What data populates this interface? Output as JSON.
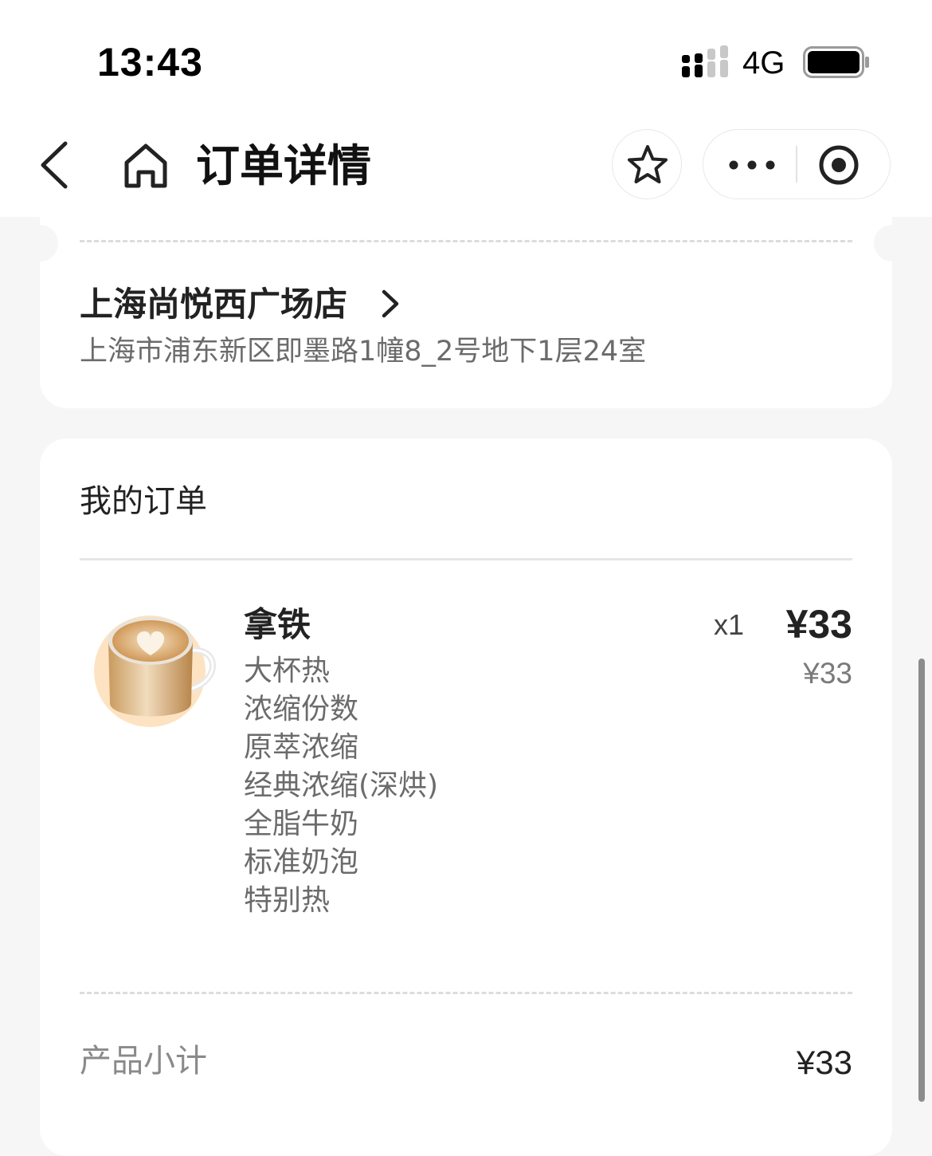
{
  "status_bar": {
    "time": "13:43",
    "network": "4G",
    "icons": [
      "signal-icon",
      "battery-icon"
    ]
  },
  "nav": {
    "title": "订单详情",
    "icons": [
      "back-arrow-icon",
      "home-icon",
      "star-icon",
      "more-dots-icon",
      "close-target-icon"
    ]
  },
  "store": {
    "name": "上海尚悦西广场店",
    "address": "上海市浦东新区即墨路1幢8_2号地下1层24室",
    "icon": "chevron-right-icon"
  },
  "order": {
    "title": "我的订单",
    "items": [
      {
        "name": "拿铁",
        "quantity": "x1",
        "price": "¥33",
        "original_price": "¥33",
        "image_icon": "latte-cup-icon",
        "options": [
          "大杯热",
          "浓缩份数",
          "原萃浓缩",
          "经典浓缩(深烘)",
          "全脂牛奶",
          "标准奶泡",
          "特别热"
        ]
      }
    ],
    "subtotal_label": "产品小计",
    "subtotal_value": "¥33"
  },
  "colors": {
    "background": "#f6f6f6",
    "card": "#ffffff",
    "text_primary": "#222222",
    "text_secondary": "#6b6b6b",
    "latte_bg": "#fde3c2"
  }
}
